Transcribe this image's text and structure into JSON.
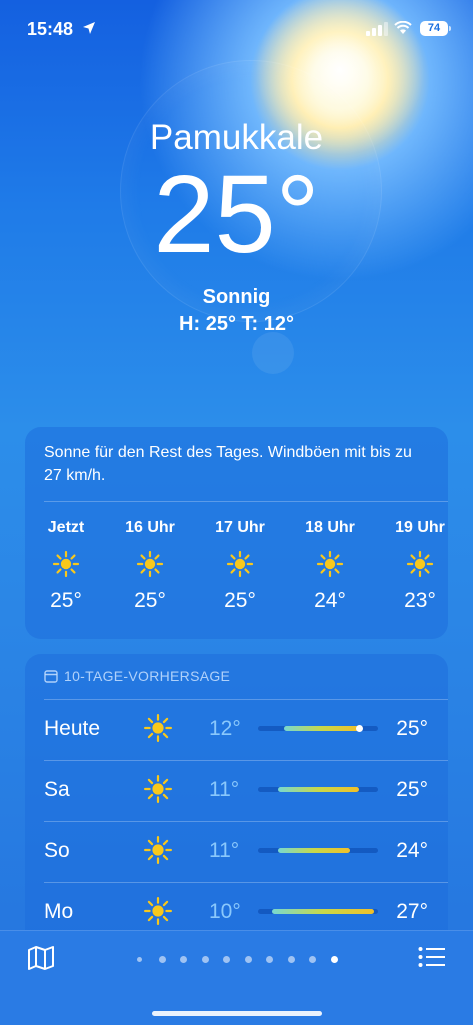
{
  "status_bar": {
    "time": "15:48",
    "battery": "74"
  },
  "current": {
    "city": "Pamukkale",
    "temperature": "25°",
    "condition": "Sonnig",
    "high_low": "H: 25°  T: 12°"
  },
  "hourly": {
    "summary": "Sonne für den Rest des Tages. Windböen mit bis zu 27 km/h.",
    "items": [
      {
        "time": "Jetzt",
        "icon": "sun-icon",
        "temp": "25°"
      },
      {
        "time": "16 Uhr",
        "icon": "sun-icon",
        "temp": "25°"
      },
      {
        "time": "17 Uhr",
        "icon": "sun-icon",
        "temp": "25°"
      },
      {
        "time": "18 Uhr",
        "icon": "sun-icon",
        "temp": "24°"
      },
      {
        "time": "19 Uhr",
        "icon": "sun-icon",
        "temp": "23°"
      }
    ]
  },
  "daily": {
    "header": "10-TAGE-VORHERSAGE",
    "days": [
      {
        "day": "Heute",
        "icon": "sun-icon",
        "low": "12°",
        "high": "25°",
        "range_start": 0.22,
        "range_end": 0.84,
        "current_marker": 0.84
      },
      {
        "day": "Sa",
        "icon": "sun-icon",
        "low": "11°",
        "high": "25°",
        "range_start": 0.17,
        "range_end": 0.84
      },
      {
        "day": "So",
        "icon": "sun-icon",
        "low": "11°",
        "high": "24°",
        "range_start": 0.17,
        "range_end": 0.77
      },
      {
        "day": "Mo",
        "icon": "sun-icon",
        "low": "10°",
        "high": "27°",
        "range_start": 0.12,
        "range_end": 0.97
      }
    ]
  },
  "bottom_bar": {
    "page_count": 10,
    "active_page": 9,
    "location_page": 0
  },
  "colors": {
    "bar_start": "#78d8d0",
    "bar_mid": "#c8d84a",
    "bar_end": "#f0c02a"
  }
}
